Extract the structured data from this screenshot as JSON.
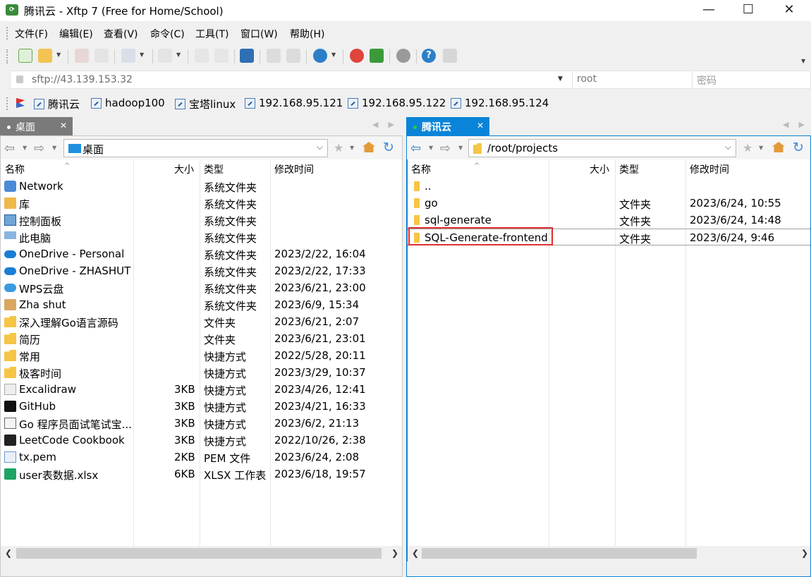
{
  "window": {
    "title": "腾讯云 - Xftp 7 (Free for Home/School)",
    "app_icon": "xftp-icon",
    "minimize": "—",
    "maximize": "☐",
    "close": "✕"
  },
  "menu": [
    "文件(F)",
    "编辑(E)",
    "查看(V)",
    "命令(C)",
    "工具(T)",
    "窗口(W)",
    "帮助(H)"
  ],
  "address": {
    "value": "sftp://43.139.153.32",
    "user": "root",
    "password_placeholder": "密码"
  },
  "links": [
    "腾讯云",
    "hadoop100",
    "宝塔linux",
    "192.168.95.121",
    "192.168.95.122",
    "192.168.95.124"
  ],
  "left": {
    "tab": "桌面",
    "path": "桌面",
    "headers": {
      "name": "名称",
      "size": "大小",
      "type": "类型",
      "modified": "修改时间"
    },
    "rows": [
      {
        "name": "Network",
        "size": "",
        "type": "系统文件夹",
        "modified": "",
        "icon": "network-icon"
      },
      {
        "name": "库",
        "size": "",
        "type": "系统文件夹",
        "modified": "",
        "icon": "library-icon"
      },
      {
        "name": "控制面板",
        "size": "",
        "type": "系统文件夹",
        "modified": "",
        "icon": "control-panel-icon"
      },
      {
        "name": "此电脑",
        "size": "",
        "type": "系统文件夹",
        "modified": "",
        "icon": "computer-icon"
      },
      {
        "name": "OneDrive - Personal",
        "size": "",
        "type": "系统文件夹",
        "modified": "2023/2/22, 16:04",
        "icon": "cloud-icon"
      },
      {
        "name": "OneDrive - ZHASHUT",
        "size": "",
        "type": "系统文件夹",
        "modified": "2023/2/22, 17:33",
        "icon": "cloud-icon"
      },
      {
        "name": "WPS云盘",
        "size": "",
        "type": "系统文件夹",
        "modified": "2023/6/21, 23:00",
        "icon": "cloud-icon"
      },
      {
        "name": "Zha shut",
        "size": "",
        "type": "系统文件夹",
        "modified": "2023/6/9, 15:34",
        "icon": "user-folder-icon"
      },
      {
        "name": "深入理解Go语言源码",
        "size": "",
        "type": "文件夹",
        "modified": "2023/6/21, 2:07",
        "icon": "folder-icon"
      },
      {
        "name": "简历",
        "size": "",
        "type": "文件夹",
        "modified": "2023/6/21, 23:01",
        "icon": "folder-icon"
      },
      {
        "name": "常用",
        "size": "",
        "type": "快捷方式",
        "modified": "2022/5/28, 20:11",
        "icon": "shortcut-folder-icon"
      },
      {
        "name": "极客时间",
        "size": "",
        "type": "快捷方式",
        "modified": "2023/3/29, 10:37",
        "icon": "shortcut-folder-icon"
      },
      {
        "name": "Excalidraw",
        "size": "3KB",
        "type": "快捷方式",
        "modified": "2023/4/26, 12:41",
        "icon": "shortcut-icon"
      },
      {
        "name": "GitHub",
        "size": "3KB",
        "type": "快捷方式",
        "modified": "2023/4/21, 16:33",
        "icon": "github-icon"
      },
      {
        "name": "Go 程序员面试笔试宝...",
        "size": "3KB",
        "type": "快捷方式",
        "modified": "2023/6/2, 21:13",
        "icon": "shortcut-icon"
      },
      {
        "name": "LeetCode Cookbook",
        "size": "3KB",
        "type": "快捷方式",
        "modified": "2022/10/26, 2:38",
        "icon": "leetcode-icon"
      },
      {
        "name": "tx.pem",
        "size": "2KB",
        "type": "PEM 文件",
        "modified": "2023/6/24, 2:08",
        "icon": "file-icon"
      },
      {
        "name": "user表数据.xlsx",
        "size": "6KB",
        "type": "XLSX 工作表",
        "modified": "2023/6/18, 19:57",
        "icon": "spreadsheet-icon"
      }
    ]
  },
  "right": {
    "tab": "腾讯云",
    "path": "/root/projects",
    "headers": {
      "name": "名称",
      "size": "大小",
      "type": "类型",
      "modified": "修改时间"
    },
    "rows": [
      {
        "name": "..",
        "size": "",
        "type": "",
        "modified": ""
      },
      {
        "name": "go",
        "size": "",
        "type": "文件夹",
        "modified": "2023/6/24, 10:55"
      },
      {
        "name": "sql-generate",
        "size": "",
        "type": "文件夹",
        "modified": "2023/6/24, 14:48"
      },
      {
        "name": "SQL-Generate-frontend",
        "size": "",
        "type": "文件夹",
        "modified": "2023/6/24, 9:46"
      }
    ]
  },
  "colors": {
    "accent_tab": "#0a84d8",
    "left_tab": "#7a7a7a",
    "highlight": "#e03030",
    "connected": "#2ecc40"
  }
}
